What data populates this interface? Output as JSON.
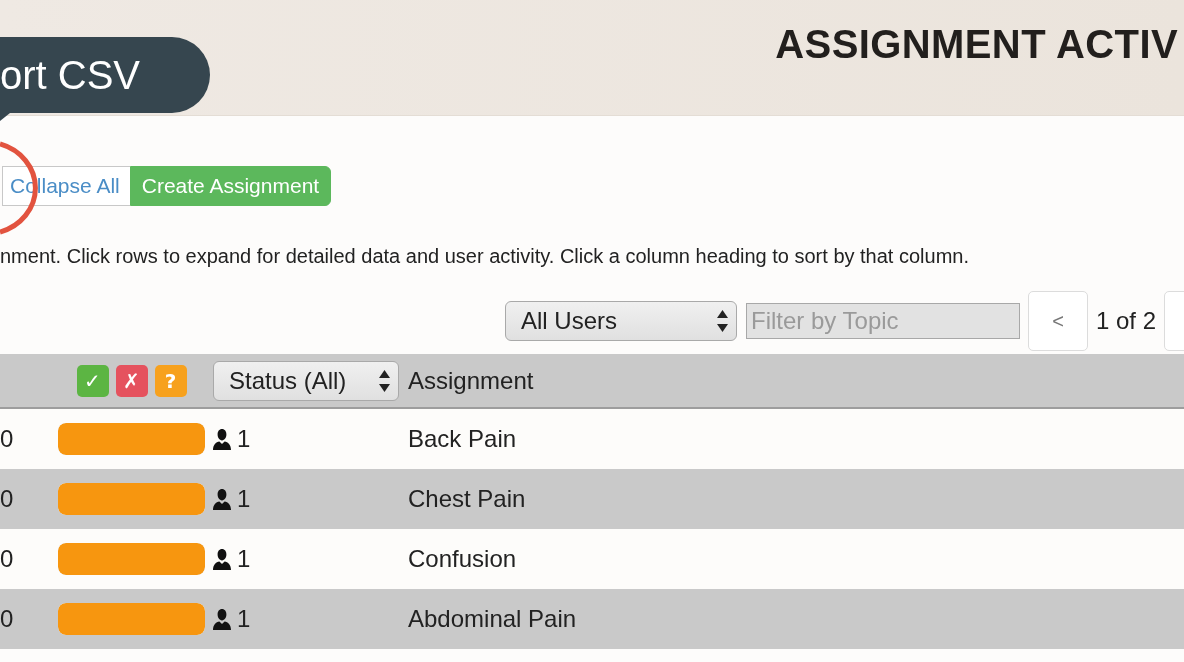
{
  "header": {
    "title": "ASSIGNMENT ACTIV"
  },
  "tooltip": {
    "text": "ort CSV"
  },
  "actions": [
    {
      "label": "Collapse All",
      "kind": "default"
    },
    {
      "label": "Create Assignment",
      "kind": "primary"
    }
  ],
  "instructions": "nment. Click rows to expand for detailed data and user activity. Click a column heading to sort by that column.",
  "filters": {
    "users": {
      "value": "All Users"
    },
    "topic": {
      "placeholder": "Filter by Topic"
    }
  },
  "pager": {
    "previous": "<",
    "position": "1 of 2"
  },
  "table": {
    "status_legend": [
      {
        "symbol": "✓",
        "color": "#5cb543"
      },
      {
        "symbol": "✗",
        "color": "#e5525e"
      },
      {
        "symbol": "?",
        "color": "#f7a11d"
      }
    ],
    "status_filter": {
      "value": "Status (All)"
    },
    "assignment_heading": "Assignment",
    "rows": [
      {
        "column_1": "0",
        "level": 1,
        "users": "1",
        "assignment": "Back Pain"
      },
      {
        "column_1": "0",
        "level": 1,
        "users": "1",
        "assignment": "Chest Pain"
      },
      {
        "column_1": "0",
        "level": 1,
        "users": "1",
        "assignment": "Confusion"
      },
      {
        "column_1": "0",
        "level": 1,
        "users": "1",
        "assignment": "Abdominal Pain"
      }
    ]
  }
}
